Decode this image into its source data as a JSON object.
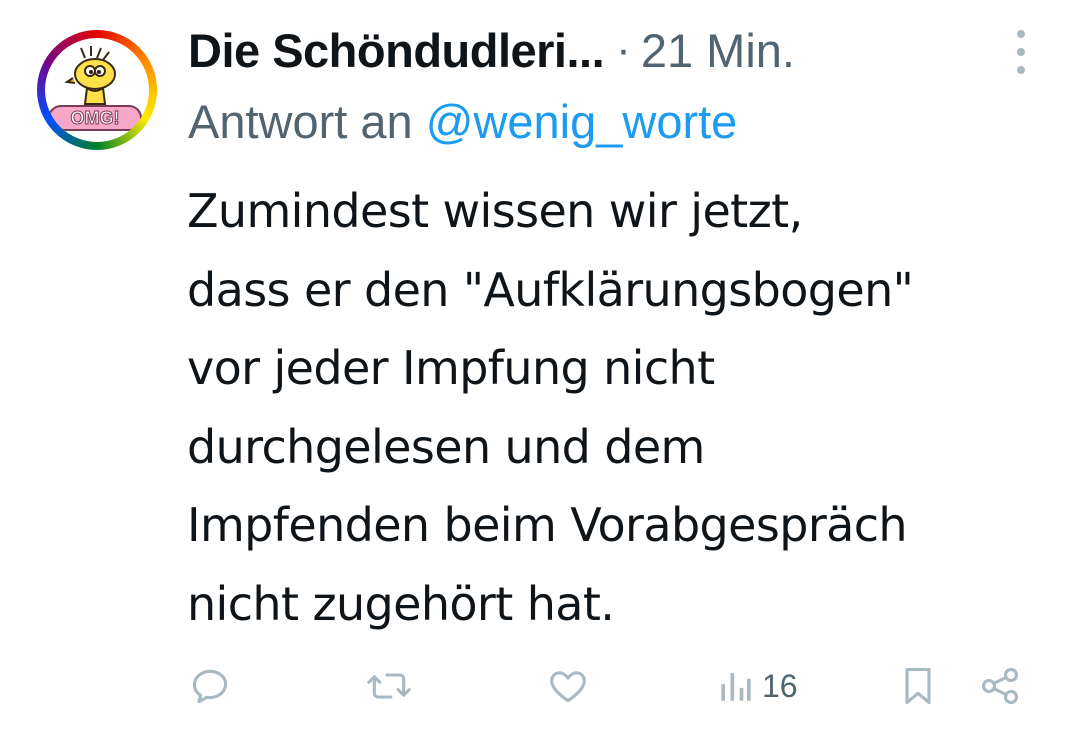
{
  "tweet": {
    "author_name": "Die Schöndudleri...",
    "separator": "·",
    "time": "21 Min.",
    "reply_prefix": "Antwort an ",
    "reply_handle": "@wenig_worte",
    "text": "Zumindest wissen wir jetzt,\ndass er den \"Aufklärungsbogen\"\nvor jeder Impfung nicht\ndurchgelesen und dem\nImpfenden beim Vorabgespräch\nnicht zugehört hat.",
    "avatar_badge": "OMG!",
    "actions": {
      "reply_icon": "reply-icon",
      "retweet_icon": "retweet-icon",
      "like_icon": "heart-icon",
      "views_icon": "views-bar-chart-icon",
      "views_count": "16",
      "bookmark_icon": "bookmark-icon",
      "share_icon": "share-icon"
    }
  },
  "colors": {
    "text": "#0f1419",
    "secondary": "#536471",
    "link": "#1d9bf0",
    "icon": "#aab8c2"
  }
}
